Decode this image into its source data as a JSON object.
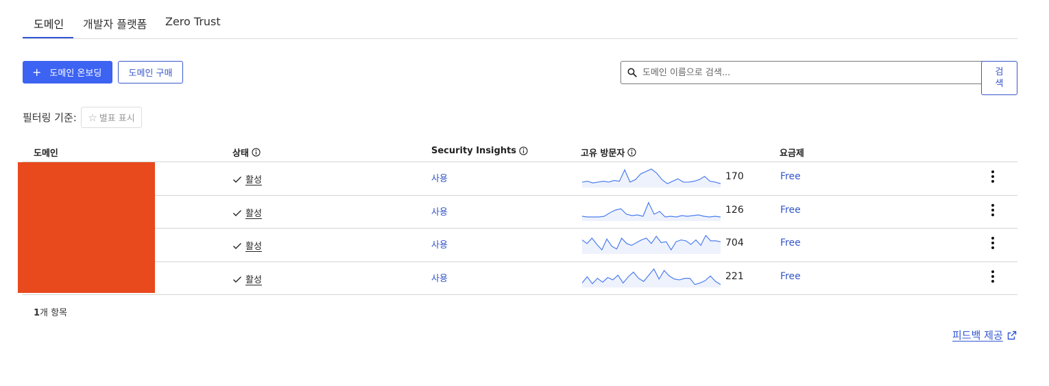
{
  "tabs": [
    {
      "label": "도메인",
      "active": true
    },
    {
      "label": "개발자 플랫폼",
      "active": false
    },
    {
      "label": "Zero Trust",
      "active": false
    }
  ],
  "toolbar": {
    "onboard_label": "도메인 온보딩",
    "buy_label": "도메인 구매"
  },
  "search": {
    "placeholder": "도메인 이름으로 검색...",
    "button_label": "검색"
  },
  "filter": {
    "label": "필터링 기준:",
    "chip_label": "별표 표시"
  },
  "table": {
    "headers": {
      "domain": "도메인",
      "status": "상태",
      "insights": "Security Insights",
      "visitors": "고유 방문자",
      "plan": "요금제"
    },
    "rows": [
      {
        "status": "활성",
        "insights": "사용",
        "visitors": "170",
        "plan": "Free",
        "spark": [
          5,
          6,
          4,
          5,
          6,
          5,
          7,
          6,
          20,
          5,
          8,
          15,
          18,
          21,
          16,
          8,
          3,
          6,
          9,
          5,
          5,
          6,
          8,
          12,
          6,
          5,
          3
        ]
      },
      {
        "status": "활성",
        "insights": "사용",
        "visitors": "126",
        "plan": "Free",
        "spark": [
          5,
          4,
          4,
          4,
          5,
          10,
          14,
          16,
          8,
          6,
          7,
          5,
          25,
          8,
          12,
          4,
          5,
          4,
          6,
          5,
          6,
          7,
          5,
          4,
          5,
          4
        ]
      },
      {
        "status": "활성",
        "insights": "사용",
        "visitors": "704",
        "plan": "Free",
        "spark": [
          14,
          10,
          16,
          9,
          3,
          15,
          7,
          4,
          16,
          10,
          8,
          11,
          14,
          16,
          10,
          18,
          11,
          12,
          3,
          12,
          14,
          13,
          9,
          14,
          8,
          19,
          13,
          13,
          12
        ]
      },
      {
        "status": "활성",
        "insights": "사용",
        "visitors": "221",
        "plan": "Free",
        "spark": [
          4,
          12,
          3,
          10,
          5,
          11,
          8,
          14,
          4,
          12,
          18,
          10,
          6,
          14,
          22,
          9,
          20,
          13,
          9,
          8,
          10,
          10,
          2,
          4,
          7,
          13,
          6,
          2
        ]
      }
    ]
  },
  "footer": {
    "count_number": "1",
    "count_suffix": "개 항목",
    "feedback_label": "피드백 제공"
  },
  "colors": {
    "accent": "#3d63f3",
    "link": "#3155c8",
    "redacted": "#e8491d",
    "sparkline": "#4a7cf0"
  }
}
